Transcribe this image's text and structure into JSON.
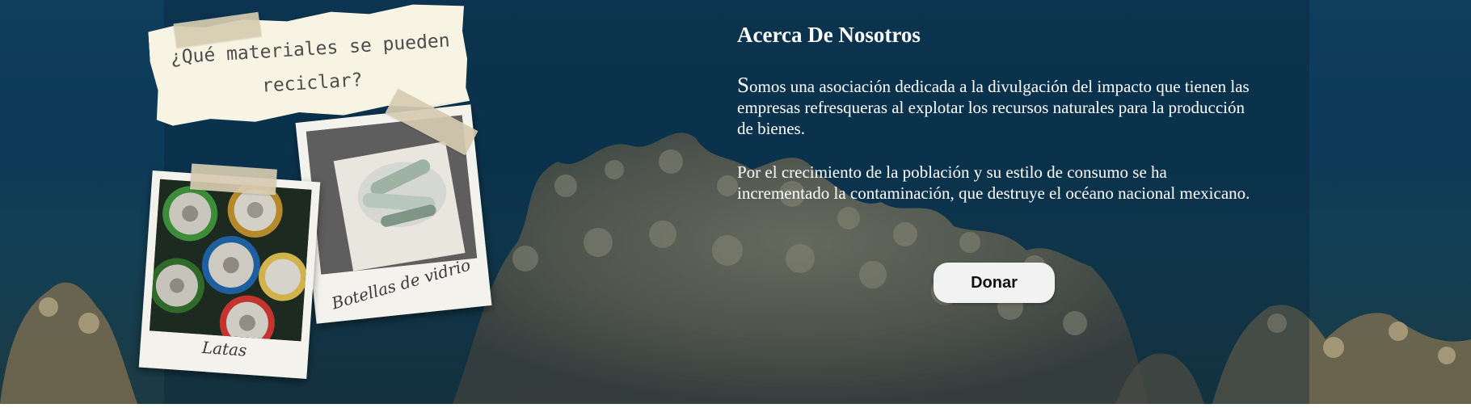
{
  "collage": {
    "note_text": "¿Qué materiales se pueden reciclar?",
    "photos": [
      {
        "caption": "Botellas de vidrio",
        "icon": "glass-bottles-photo"
      },
      {
        "caption": "Latas",
        "icon": "cans-photo"
      }
    ]
  },
  "about": {
    "title": "Acerca De Nosotros",
    "paragraphs": [
      "Somos una asociación dedicada a la divulgación del impacto que tienen las empresas refresqueras al explotar los recursos naturales para la producción de bienes.",
      "Por el crecimiento de la población y su estilo de consumo se ha incrementado la contaminación, que destruye el océano nacional mexicano."
    ],
    "donate_label": "Donar"
  },
  "colors": {
    "background": "#0f3d5c",
    "text": "#ffffff",
    "button_bg": "#f2f2f2",
    "note_paper": "#f7f4e3",
    "tape": "#d6cbb0"
  }
}
